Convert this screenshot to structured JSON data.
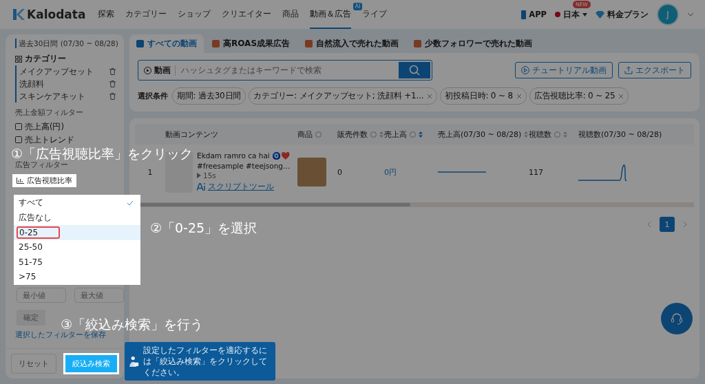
{
  "nav": {
    "logo": "Kalodata",
    "items": [
      {
        "label": "探索",
        "selected": false
      },
      {
        "label": "カテゴリー",
        "selected": false
      },
      {
        "label": "ショップ",
        "selected": false
      },
      {
        "label": "クリエイター",
        "selected": false
      },
      {
        "label": "商品",
        "selected": false
      },
      {
        "label": "動画＆広告",
        "selected": true,
        "badge": "AI"
      },
      {
        "label": "ライブ",
        "selected": false
      }
    ],
    "app": "APP",
    "region": "日本",
    "region_badge": "NEW",
    "pricing": "料金プラン",
    "avatar": "J"
  },
  "sidebar": {
    "period": "過去30日間 (07/30 ~ 08/28)",
    "category_title": "カテゴリー",
    "categories": [
      "メイクアップセット",
      "洗顔料",
      "スキンケアキット"
    ],
    "sales_filter_title": "売上金額フィルター",
    "sales_items": [
      "売上高(円)",
      "売上トレンド"
    ],
    "ad_filter_title": "広告フィルター",
    "ad_filter_label": "広告視聴比率",
    "options": [
      {
        "label": "すべて",
        "selected": true,
        "highlighted": false
      },
      {
        "label": "広告なし",
        "selected": false,
        "highlighted": false
      },
      {
        "label": "0-25",
        "selected": false,
        "highlighted": true
      },
      {
        "label": "25-50",
        "selected": false,
        "highlighted": false
      },
      {
        "label": "51-75",
        "selected": false,
        "highlighted": false
      },
      {
        "label": ">75",
        "selected": false,
        "highlighted": false
      }
    ],
    "min_placeholder": "最小値",
    "max_placeholder": "最大値",
    "confirm": "確定",
    "save_link": "選択したフィルターを保存",
    "reset": "リセット",
    "search": "絞込み検索"
  },
  "tooltip": "設定したフィルターを適応するには「絞込み検索」をクリックしてください。",
  "tabs": [
    {
      "label": "すべての動画",
      "selected": true
    },
    {
      "label": "高ROAS成果広告",
      "selected": false
    },
    {
      "label": "自然流入で売れた動画",
      "selected": false
    },
    {
      "label": "少数フォロワーで売れた動画",
      "selected": false
    }
  ],
  "search": {
    "scope": "動画",
    "placeholder": "ハッシュタグまたはキーワードで検索"
  },
  "buttons": [
    "チュートリアル動画",
    "エクスポート"
  ],
  "conditions_label": "選択条件",
  "conditions": [
    {
      "text": "期間: 過去30日間",
      "removable": false
    },
    {
      "text": "カテゴリー: メイクアップセット; 洗顔料 +1...",
      "removable": true
    },
    {
      "text": "初投稿日時: 0 ~ 8",
      "removable": true
    },
    {
      "text": "広告視聴比率: 0 ~ 25",
      "removable": true
    }
  ],
  "table": {
    "columns": [
      {
        "label": "動画コンテンツ",
        "help": false,
        "sort": false
      },
      {
        "label": "商品",
        "help": true,
        "sort": false
      },
      {
        "label": "販売件数",
        "help": true,
        "sort": true
      },
      {
        "label": "売上高",
        "help": true,
        "sort": true
      },
      {
        "label": "売上高(07/30 ~ 08/28)",
        "help": false,
        "sort": true
      },
      {
        "label": "視聴数",
        "help": true,
        "sort": true
      },
      {
        "label": "視聴数(07/30 ~ 08/28)",
        "help": false,
        "sort": false
      }
    ],
    "rows": [
      {
        "index": "1",
        "title": "Ekdam ramro ca hai 🧿❤️",
        "tags": "#freesample #teejsong…",
        "duration": "15s",
        "script_link": "スクリプトツール",
        "sales_count": "0",
        "revenue": "0円",
        "views": "117"
      }
    ]
  },
  "pagination": {
    "pages": [
      {
        "label": "1",
        "selected": true
      }
    ]
  },
  "annotations": [
    {
      "text": "①「広告視聴比率」をクリック",
      "kind": "step1"
    },
    {
      "text": "②「0-25」を選択",
      "kind": "step2"
    },
    {
      "text": "③「絞込み検索」を行う",
      "kind": "step3"
    }
  ]
}
